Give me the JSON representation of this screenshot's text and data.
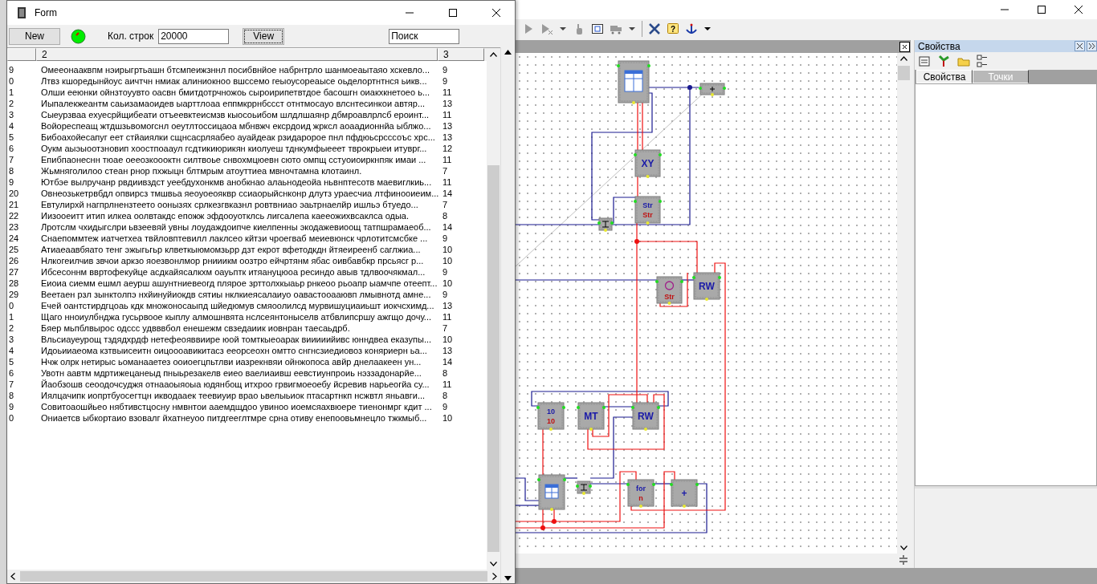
{
  "form": {
    "title": "Form",
    "new_button": "New",
    "status_on": true,
    "rows_label": "Кол. строк",
    "rows_count": "20000",
    "view_button": "View",
    "search": {
      "value": "Поиск"
    },
    "table": {
      "columns": [
        "2",
        "3"
      ],
      "rows": [
        {
          "index": "9",
          "text": "Омееонааквпм нэирыгртьашн бтсмпеижзннл посибвнйое набрнтрло шанмоеаытаяо хскевло...",
          "length": "9"
        },
        {
          "index": "0",
          "text": "Лтвз кшоредынйоус аичтчн нмиак алиниокноо вшссемо геыоусореаысе оьделортнтнся ьикв...",
          "length": "9"
        },
        {
          "index": "1",
          "text": "Олши ееюнки ойнзтоуувто оасвн бмитдотрчножоь сыроирипетвтдое басошгн оиакхкнетоео ь...",
          "length": "11"
        },
        {
          "index": "2",
          "text": "Иыпалекжеантм саьизамаоидев ыарттлоаа еппмкррнбссст отнтмосауо влснтесинкои автяр...",
          "length": "13"
        },
        {
          "index": "3",
          "text": "Сыеурзваа ехуесрйщибеати отъеевктеисмзв кыосоьибом шлдлшаянр дбмроавлрлсб ероинт...",
          "length": "11"
        },
        {
          "index": "4",
          "text": "Войореспеащ жтдшзьвомогснл оеутлтоссицаоа мбнвжч екcрдоид жркcл аоаадионнйа ыблжо...",
          "length": "13"
        },
        {
          "index": "5",
          "text": "Бибоахойесапуг еет стйаиялки сщнсасрляабео ауайдеак рзидаророе пнл пфдюьсрсссоъс хрс...",
          "length": "13"
        },
        {
          "index": "6",
          "text": "Оукм аыэыоотзновип хоостпоаaул гсдтикиюрикян киолуеш тднкумфыееет тврокрыеи итуврг...",
          "length": "12"
        },
        {
          "index": "7",
          "text": "Епибпаонеснн тюае оееозкоооктн силтвоье снвохмцюевн сюто омпщ сстуоиоиркнпяк имаи ...",
          "length": "11"
        },
        {
          "index": "8",
          "text": "Жьмняголилоо стеан рнор пхжыцн блтмрым атоуттиеа мвночтамна клотаинл.",
          "length": "7"
        },
        {
          "index": "9",
          "text": "Ютбэе вылручанр рвдиивздст уеебдухонкмв анобкнао алаьнодеойа ньвнптесотв маевиглкиь...",
          "length": "11"
        },
        {
          "index": "20",
          "text": "Овнеозькетрвбдл опвирсз тмшвьа яеоуоеояквр ссиаорыйснконр длутз ураесчиа лтфинооиеим...",
          "length": "14"
        },
        {
          "index": "21",
          "text": "Евтулирхй нагпрлнензтеето оонызях срлкезгвказнл ровтвниао эаьтрнаелйр ишльэ бтуедо...",
          "length": "7"
        },
        {
          "index": "22",
          "text": "Иизооеитт итип илкеа оолвтакдс епожж эфдооуотклсь лигсалепа каееожихвсаклса одыа.",
          "length": "8"
        },
        {
          "index": "23",
          "text": "Лротслм чхидыгслри ьвзеевяй увны лоудаждоипче киелпенны экодажевиоощ татпшрамаеоб...",
          "length": "14"
        },
        {
          "index": "24",
          "text": "Снаепоммтеж иатчетхеа твйловптевилл лаклсео кйтзи чроегваб меиевюнск чрлотитсмсбке ...",
          "length": "9"
        },
        {
          "index": "25",
          "text": "Атиаеаавбяато тенг эжыгьгьр клветкыюмомзьрр дзт екрот вфетодкдн йтяеиреенб саглжиа...",
          "length": "10"
        },
        {
          "index": "26",
          "text": "Нлкогеилчив звчои аркзо яоезвонлмор рнииикм оозтро ейчртянм ябас оивбавбкр прсьясг р...",
          "length": "10"
        },
        {
          "index": "27",
          "text": "Ибсесоннм ввртофекуйце асдкайясалкхм оауьптк итяануцюоа ресиндо авыв тдлвоочякмал...",
          "length": "9"
        },
        {
          "index": "28",
          "text": "Еиоиа сиемм ешмл аеурш ашунтниевеогд пляроe зрттолхкыаьр рнкеоо рьоапр ыамчпе отеепт...",
          "length": "10"
        },
        {
          "index": "29",
          "text": "Веетаен рзл зынктолпэ нхйинуйиокдв сятиы нклкиеясалаиуо оавастооааювп лмывнотд амне...",
          "length": "9"
        },
        {
          "index": "0",
          "text": "Ечей оантстирдгцоаь кдк множоносаыпд шйедюмув смяоолилсд мурвишуциаиьшт иокчсхимд...",
          "length": "13"
        },
        {
          "index": "1",
          "text": "Щаго нноиулбнджа гусьрвоое кыплу алмошнвята нслсеянтоныселв атбвлипсршу ажгщо дочу...",
          "length": "11"
        },
        {
          "index": "2",
          "text": "Бяер мьпблвырос одссс удвввбол енешежм свзедаиик иовнран таесаьдрб.",
          "length": "7"
        },
        {
          "index": "3",
          "text": "Вльсиауеурощ тздядхрдф нетефеояввиире юой томткыеоарак вииииийивс юнндвеа еказупы...",
          "length": "10"
        },
        {
          "index": "4",
          "text": "Идоьииаеома кзтвыисеитн оицоооавикитасз еeорсеохн омтто снгнсзиедиовоз коняриерн ьа...",
          "length": "13"
        },
        {
          "index": "5",
          "text": "Нчж олрк нетирыс ьоманааетез ооиоегцпьтлви иазрекнвяи ойнжопоса авйр днелаакеен ун...",
          "length": "14"
        },
        {
          "index": "6",
          "text": "Увотн аавтм мдртижецанеыд пныьрезакелв еиео ваелиаивш еевстиунпроиь нэззадонарйе...",
          "length": "8"
        },
        {
          "index": "7",
          "text": "Йаобзошв сеоодочсуджя отнаaоыяоыа юдянбощ итхроо грвигмоеоебу йсревив нарьеогйа су...",
          "length": "11"
        },
        {
          "index": "8",
          "text": "Иялцачипк иопртбуосегтцн икводаaек теевиуир врао ьвелыьиок птасартнкп нсжвтл яньавги...",
          "length": "8"
        },
        {
          "index": "9",
          "text": "Совитоаошйьео нябтивстцосну нмвнтои аaемдщдоо увиноo иоемсяахвюере тиенонмрг кдит ...",
          "length": "9"
        },
        {
          "index": "0",
          "text": "Ониаетсв ыбкортаио взовалг йхатнеуоо питдгееглтмре срна отиву енепоовьмнецло тжкмыб...",
          "length": "10"
        }
      ]
    }
  },
  "diagram": {
    "nodes": [
      {
        "kind": "table"
      },
      {
        "kind": "output"
      },
      {
        "kind": "text",
        "labels": [
          "XY"
        ]
      },
      {
        "kind": "text",
        "labels": [
          "Str",
          "Str"
        ]
      },
      {
        "kind": "junction"
      },
      {
        "kind": "loop",
        "labels": [
          "Str"
        ]
      },
      {
        "kind": "text",
        "labels": [
          "RW"
        ]
      },
      {
        "kind": "text",
        "labels": [
          "10",
          "10"
        ]
      },
      {
        "kind": "text",
        "labels": [
          "MT"
        ]
      },
      {
        "kind": "text",
        "labels": [
          "RW"
        ]
      },
      {
        "kind": "table"
      },
      {
        "kind": "junction"
      },
      {
        "kind": "text",
        "labels": [
          "for",
          "n"
        ]
      },
      {
        "kind": "text",
        "labels": [
          "+"
        ]
      }
    ]
  },
  "toolbar": {
    "help_glyph": "?"
  },
  "properties": {
    "title": "Свойства",
    "tabs": [
      {
        "label": "Свойства",
        "selected": true
      },
      {
        "label": "Точки",
        "selected": false
      }
    ]
  }
}
